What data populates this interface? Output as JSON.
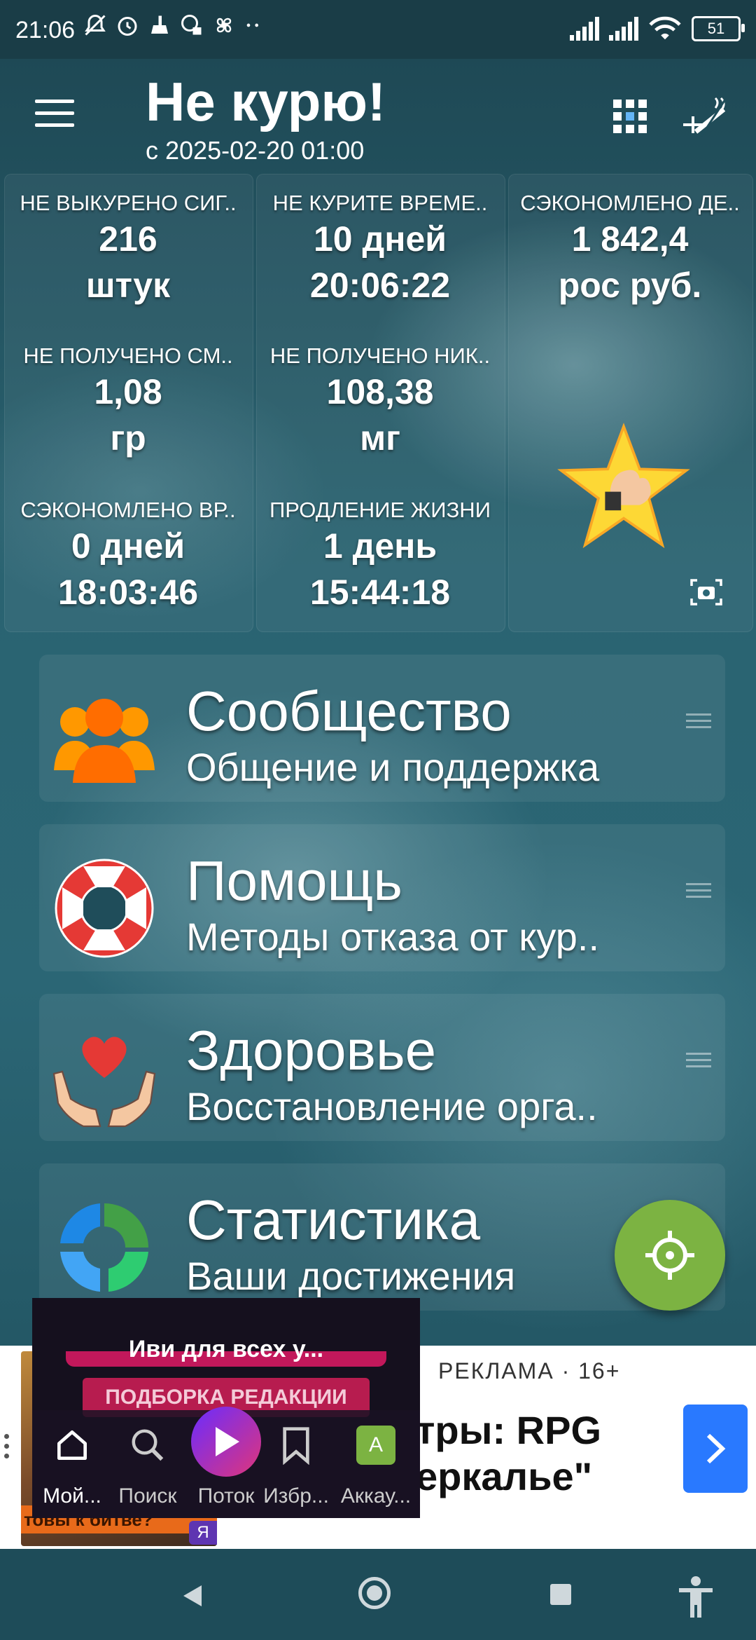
{
  "status_bar": {
    "time": "21:06",
    "battery": "51",
    "left_icons": [
      "muted-bell-icon",
      "alarm-icon",
      "cleaner-icon",
      "vpn-icon",
      "fan-icon",
      "more-dots-icon"
    ],
    "right_icons": [
      "signal-1-icon",
      "signal-2-icon",
      "wifi-icon",
      "battery-icon"
    ]
  },
  "app_bar": {
    "title": "Не курю!",
    "subtitle": "с 2025-02-20 01:00",
    "icons": [
      "menu-icon",
      "grid-icon",
      "smoking-icon"
    ]
  },
  "stats": [
    {
      "label": "НЕ ВЫКУРЕНО СИГ..",
      "value": "216",
      "unit": "штук"
    },
    {
      "label": "НЕ КУРИТЕ ВРЕМЕ..",
      "value": "10 дней",
      "unit": "20:06:22"
    },
    {
      "label": "СЭКОНОМЛЕНО ДЕ..",
      "value": "1 842,4",
      "unit": "рос руб."
    },
    {
      "label": "НЕ ПОЛУЧЕНО СМ..",
      "value": "1,08",
      "unit": "гр"
    },
    {
      "label": "НЕ ПОЛУЧЕНО НИК..",
      "value": "108,38",
      "unit": "мг"
    },
    {
      "label": "СЭКОНОМЛЕНО ВР..",
      "value": "0 дней",
      "unit": "18:03:46"
    },
    {
      "label": "ПРОДЛЕНИЕ ЖИЗНИ",
      "value": "1 день",
      "unit": "15:44:18"
    }
  ],
  "menu": [
    {
      "title": "Сообщество",
      "subtitle": "Общение и поддержка",
      "icon": "community-icon"
    },
    {
      "title": "Помощь",
      "subtitle": "Методы отказа от кур..",
      "icon": "lifebuoy-icon"
    },
    {
      "title": "Здоровье",
      "subtitle": "Восстановление орга..",
      "icon": "health-heart-icon"
    },
    {
      "title": "Статистика",
      "subtitle": "Ваши достижения",
      "icon": "statistics-ring-icon"
    }
  ],
  "fab": {
    "icon": "crosshair-icon"
  },
  "ad": {
    "label": "РЕКЛАМА · 16+",
    "title": "тры: RPG\nеркалье\"",
    "image_text": "товы к битве?",
    "badge": "Я"
  },
  "mini_player": {
    "banner": "Иви для всех у...",
    "collection": "ПОДБОРКА РЕДАКЦИИ",
    "tabs": [
      {
        "label": "Мой...",
        "icon": "home-icon"
      },
      {
        "label": "Поиск",
        "icon": "search-icon"
      },
      {
        "label": "Поток",
        "icon": "play-icon"
      },
      {
        "label": "Избр...",
        "icon": "bookmark-icon"
      },
      {
        "label": "Аккау...",
        "icon": "account-icon",
        "avatar": "A"
      }
    ]
  },
  "nav_bar": {
    "icons": [
      "back-icon",
      "home-circle-icon",
      "recents-icon",
      "accessibility-icon"
    ]
  },
  "colors": {
    "fab": "#7cb342",
    "ad_button": "#2979ff",
    "star": "#fdd835"
  }
}
